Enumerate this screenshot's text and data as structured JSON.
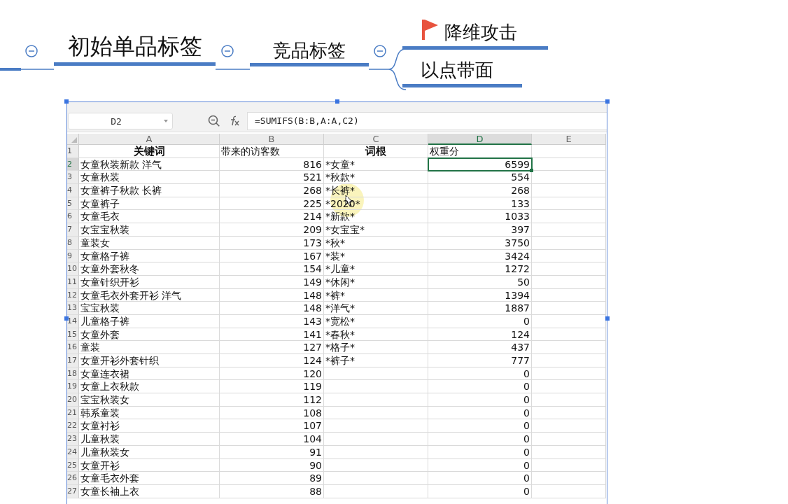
{
  "mindmap": {
    "nodes": [
      {
        "text": "初始单品标签",
        "collapsed": false
      },
      {
        "text": "竞品标签",
        "collapsed": false
      }
    ],
    "children": [
      {
        "text": "降维攻击",
        "flag": true
      },
      {
        "text": "以点带面",
        "flag": false
      }
    ]
  },
  "spreadsheet": {
    "name_box": "D2",
    "formula": "=SUMIFS(B:B,A:A,C2)",
    "columns": [
      {
        "label": "A",
        "selected": false
      },
      {
        "label": "B",
        "selected": false
      },
      {
        "label": "C",
        "selected": false
      },
      {
        "label": "D",
        "selected": true
      },
      {
        "label": "E",
        "selected": false
      }
    ],
    "rows": [
      {
        "n": "1",
        "kind": "header",
        "selected": false,
        "cells": [
          {
            "text": "关键词",
            "bold": true
          },
          {
            "text": "带来的访客数",
            "bold": false
          },
          {
            "text": "词根",
            "bold": true
          },
          {
            "text": "权重分",
            "bold": false
          }
        ]
      },
      {
        "n": "2",
        "selected": true,
        "cells": [
          "女童秋装新款 洋气",
          "816",
          "*女童*",
          "6599"
        ]
      },
      {
        "n": "3",
        "selected": false,
        "cells": [
          "女童秋装",
          "521",
          "*秋款*",
          "554"
        ]
      },
      {
        "n": "4",
        "selected": false,
        "cells": [
          "女童裤子秋款 长裤",
          "268",
          "*长裤*",
          "268"
        ]
      },
      {
        "n": "5",
        "selected": false,
        "cells": [
          "女童裤子",
          "225",
          "*2020*",
          "133"
        ]
      },
      {
        "n": "6",
        "selected": false,
        "cells": [
          "女童毛衣",
          "214",
          "*新款*",
          "1033"
        ]
      },
      {
        "n": "7",
        "selected": false,
        "cells": [
          "女宝宝秋装",
          "209",
          "*女宝宝*",
          "397"
        ]
      },
      {
        "n": "8",
        "selected": false,
        "cells": [
          "童装女",
          "173",
          "*秋*",
          "3750"
        ]
      },
      {
        "n": "9",
        "selected": false,
        "cells": [
          "女童格子裤",
          "167",
          "*装*",
          "3424"
        ]
      },
      {
        "n": "10",
        "selected": false,
        "cells": [
          "女童外套秋冬",
          "154",
          "*儿童*",
          "1272"
        ]
      },
      {
        "n": "11",
        "selected": false,
        "cells": [
          "女童针织开衫",
          "149",
          "*休闲*",
          "50"
        ]
      },
      {
        "n": "12",
        "selected": false,
        "cells": [
          "女童毛衣外套开衫 洋气",
          "148",
          "*裤*",
          "1394"
        ]
      },
      {
        "n": "13",
        "selected": false,
        "cells": [
          "宝宝秋装",
          "148",
          "*洋气*",
          "1887"
        ]
      },
      {
        "n": "14",
        "selected": false,
        "cells": [
          "儿童格子裤",
          "143",
          "*宽松*",
          "0"
        ]
      },
      {
        "n": "15",
        "selected": false,
        "cells": [
          "女童外套",
          "141",
          "*春秋*",
          "124"
        ]
      },
      {
        "n": "16",
        "selected": false,
        "cells": [
          "童装",
          "127",
          "*格子*",
          "437"
        ]
      },
      {
        "n": "17",
        "selected": false,
        "cells": [
          "女童开衫外套针织",
          "124",
          "*裤子*",
          "777"
        ]
      },
      {
        "n": "18",
        "selected": false,
        "cells": [
          "女童连衣裙",
          "120",
          null,
          "0"
        ]
      },
      {
        "n": "19",
        "selected": false,
        "cells": [
          "女童上衣秋款",
          "119",
          null,
          "0"
        ]
      },
      {
        "n": "20",
        "selected": false,
        "cells": [
          "宝宝秋装女",
          "112",
          null,
          "0"
        ]
      },
      {
        "n": "21",
        "selected": false,
        "cells": [
          "韩系童装",
          "108",
          null,
          "0"
        ]
      },
      {
        "n": "22",
        "selected": false,
        "cells": [
          "女童衬衫",
          "107",
          null,
          "0"
        ]
      },
      {
        "n": "23",
        "selected": false,
        "cells": [
          "儿童秋装",
          "104",
          null,
          "0"
        ]
      },
      {
        "n": "24",
        "selected": false,
        "cells": [
          "儿童秋装女",
          "91",
          null,
          "0"
        ]
      },
      {
        "n": "25",
        "selected": false,
        "cells": [
          "女童开衫",
          "90",
          null,
          "0"
        ]
      },
      {
        "n": "26",
        "selected": false,
        "cells": [
          "女童毛衣外套",
          "89",
          null,
          "0"
        ]
      },
      {
        "n": "27",
        "selected": false,
        "cells": [
          "女童长袖上衣",
          "88",
          null,
          "0"
        ]
      }
    ]
  }
}
